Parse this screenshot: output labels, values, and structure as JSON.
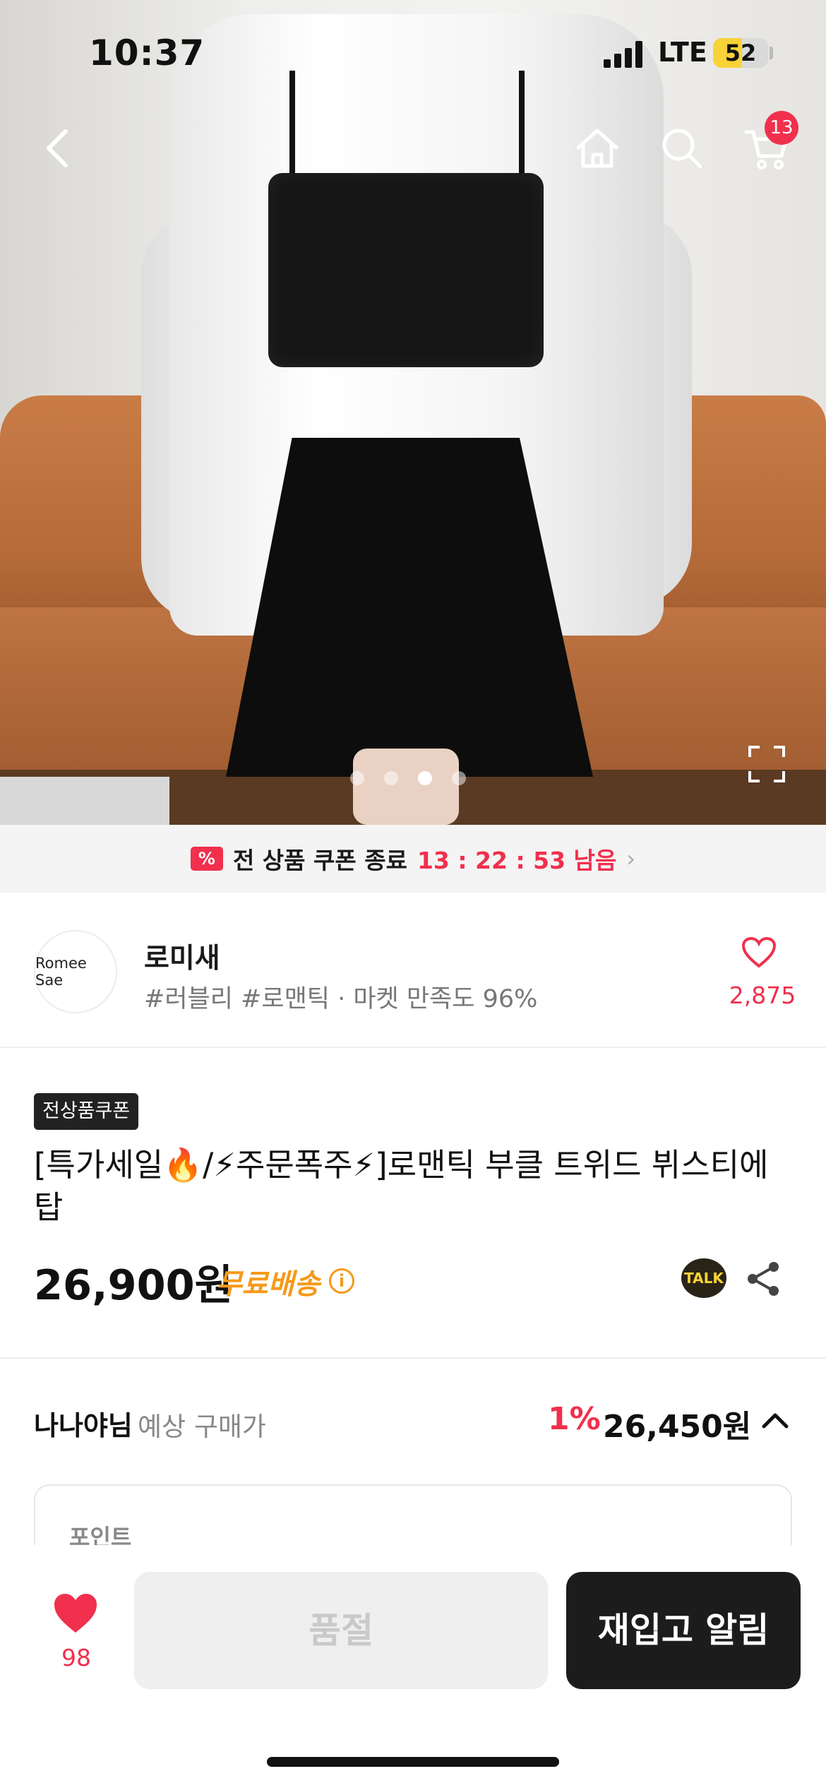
{
  "status_bar": {
    "time": "10:37",
    "network": "LTE",
    "battery": "52",
    "battery_level": 0.52
  },
  "nav": {
    "back_icon": "chevron-left-icon",
    "home_icon": "home-icon",
    "search_icon": "search-icon",
    "cart_icon": "cart-icon",
    "cart_count": "13"
  },
  "gallery": {
    "image_count": 4,
    "active_index": 2
  },
  "coupon_banner": {
    "text": "전 상품 쿠폰 종료",
    "countdown": "13 : 22 : 53 남음",
    "chevron": "›"
  },
  "store": {
    "logo_text": "Romee Sae",
    "name": "로미새",
    "tags": "#러블리 #로맨틱 · 마켓 만족도 96%",
    "likes": "2,875"
  },
  "product": {
    "badge": "전상품쿠폰",
    "title": "[특가세일🔥/⚡주문폭주⚡]로맨틱 부클 트위드 뷔스티에탑",
    "price": "26,900원",
    "shipping": "무료배송",
    "info_mark": "i",
    "talk_label": "TALK"
  },
  "estimate": {
    "user": "나나야님",
    "label": "예상 구매가",
    "discount": "1%",
    "price": "26,450원"
  },
  "points": {
    "label": "포인트"
  },
  "bottom_bar": {
    "favorite_count": "98",
    "soldout_label": "품절",
    "restock_label": "재입고 알림"
  },
  "colors": {
    "accent_red": "#f0304d",
    "shipping_orange": "#f49a19",
    "dark_button": "#1c1c1c"
  }
}
